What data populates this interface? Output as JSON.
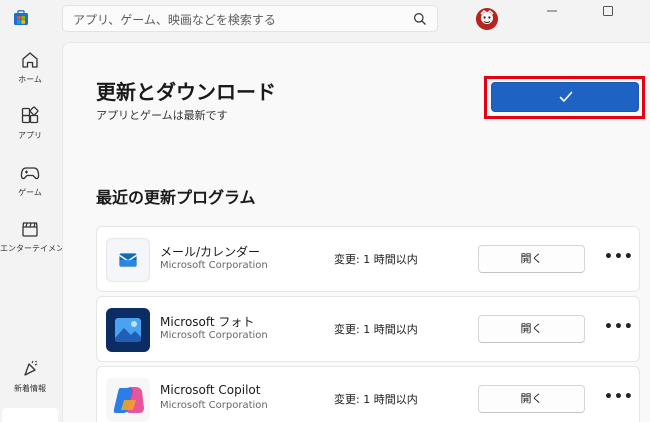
{
  "titlebar": {
    "logo_icon": "microsoft-store-icon",
    "search_placeholder": "アプリ、ゲーム、映画などを検索する",
    "search_icon": "search-icon",
    "avatar_icon": "user-avatar"
  },
  "nav": {
    "items": [
      {
        "label": "ホーム",
        "icon": "home-icon"
      },
      {
        "label": "アプリ",
        "icon": "apps-icon"
      },
      {
        "label": "ゲーム",
        "icon": "gamepad-icon"
      },
      {
        "label": "エンターテイメント",
        "icon": "clapperboard-icon"
      },
      {
        "label": "新着情報",
        "icon": "whats-new-icon"
      }
    ]
  },
  "main": {
    "title": "更新とダウンロード",
    "subtitle": "アプリとゲームは最新です",
    "check_icon": "checkmark-icon",
    "section_title": "最近の更新プログラム",
    "apps": [
      {
        "name": "メール/カレンダー",
        "publisher": "Microsoft Corporation",
        "status": "変更: 1 時間以内",
        "open_label": "開く",
        "more_label": "•••"
      },
      {
        "name": "Microsoft フォト",
        "publisher": "Microsoft Corporation",
        "status": "変更: 1 時間以内",
        "open_label": "開く",
        "more_label": "•••"
      },
      {
        "name": "Microsoft Copilot",
        "publisher": "Microsoft Corporation",
        "status": "変更: 1 時間以内",
        "open_label": "開く",
        "more_label": "•••"
      }
    ]
  },
  "colors": {
    "accent": "#1e63c3",
    "highlight": "#e60012"
  }
}
